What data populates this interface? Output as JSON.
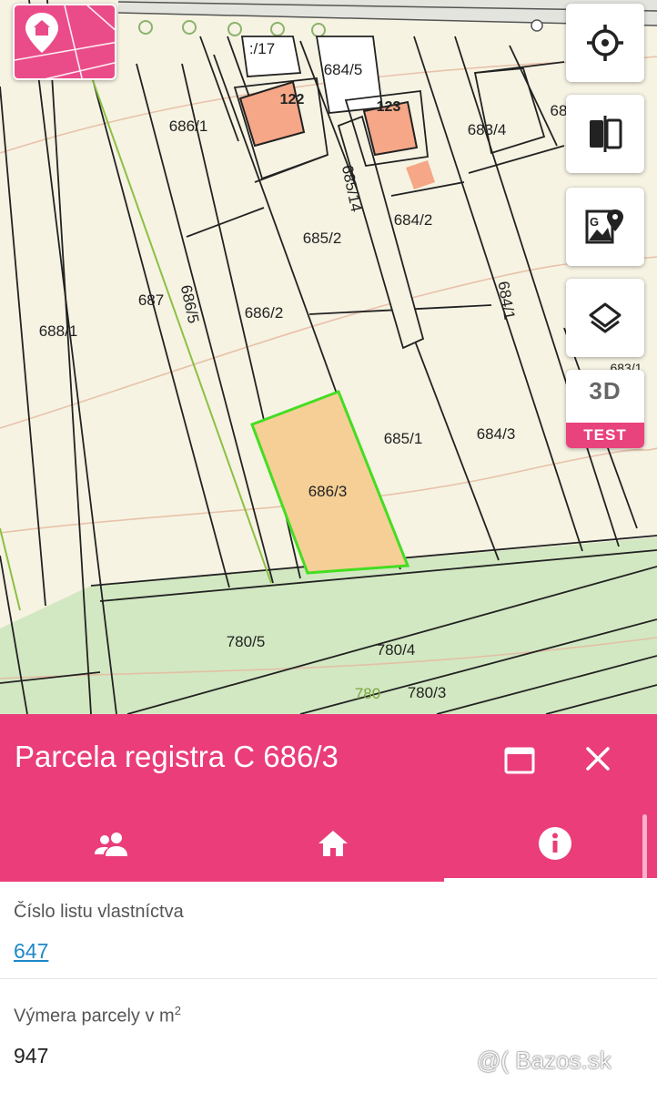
{
  "map": {
    "parcels": [
      {
        "label": "686/1",
        "cls": ""
      },
      {
        "label": "688/1",
        "cls": ""
      },
      {
        "label": "687",
        "cls": ""
      },
      {
        "label": "686/5",
        "cls": "rot"
      },
      {
        "label": "686/2",
        "cls": ""
      },
      {
        "label": "685/2",
        "cls": ""
      },
      {
        "label": "684/2",
        "cls": ""
      },
      {
        "label": "685/1",
        "cls": ""
      },
      {
        "label": "684/3",
        "cls": ""
      },
      {
        "label": "684/1",
        "cls": "rot2"
      },
      {
        "label": "683/4",
        "cls": ""
      },
      {
        "label": "684/5",
        "cls": ""
      },
      {
        "label": ":/17",
        "cls": ""
      },
      {
        "label": "685/14",
        "cls": "rot"
      },
      {
        "label": "686/3",
        "cls": ""
      },
      {
        "label": "780/5",
        "cls": ""
      },
      {
        "label": "780/4",
        "cls": ""
      },
      {
        "label": "780/3",
        "cls": ""
      },
      {
        "label": "780",
        "cls": "green"
      },
      {
        "label": "683/1",
        "cls": ""
      },
      {
        "label": "68",
        "cls": ""
      }
    ],
    "buildings": [
      "122",
      "123"
    ],
    "selected_parcel": "686/3",
    "selected_outline_color": "#44dd22",
    "selected_fill_color": "#f5cf96",
    "building_color": "#f5a787"
  },
  "controls": {
    "logo_icon": "home-pin-icon",
    "locate_icon": "crosshair-icon",
    "compare_icon": "split-compare-icon",
    "map_source_icon": "google-map-icon",
    "layers_icon": "layers-icon",
    "three_d_label": "3D",
    "test_label": "TEST"
  },
  "panel": {
    "title": "Parcela registra C 686/3",
    "maximize_icon": "maximize-icon",
    "close_icon": "close-icon",
    "accent_color": "#ea3d79",
    "tabs": [
      {
        "icon": "people-icon"
      },
      {
        "icon": "home-icon"
      },
      {
        "icon": "info-icon"
      }
    ],
    "active_tab": 2
  },
  "fields": {
    "lv_label": "Číslo listu vlastníctva",
    "lv_value": "647",
    "area_label": "Výmera parcely v m",
    "area_label_sup": "2",
    "area_value": "947"
  },
  "watermark": "@( Bazos.sk"
}
